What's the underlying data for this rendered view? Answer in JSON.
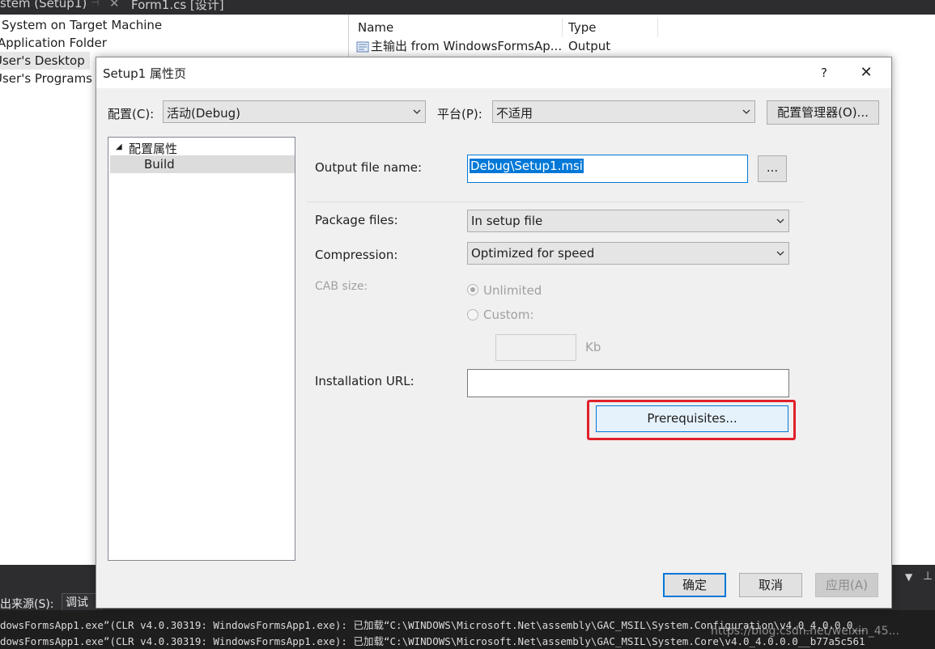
{
  "ide": {
    "tabs": [
      {
        "label": "stem (Setup1)"
      },
      {
        "label": "Form1.cs [设计]"
      }
    ],
    "tab_pin_icon": "pin-icon",
    "tab_close_icon": "close-icon",
    "file_system_tree": [
      {
        "label": "System on Target Machine"
      },
      {
        "label": "Application Folder"
      },
      {
        "label": "User's Desktop"
      },
      {
        "label": "User's Programs Menu"
      }
    ],
    "list_columns": [
      "Name",
      "Type"
    ],
    "list_rows": [
      {
        "name": "主输出 from WindowsFormsAp...",
        "type": "Output"
      }
    ],
    "output_panel": {
      "source_label": "出来源(S):",
      "source_value": "调试",
      "lines": [
        "dowsFormsApp1.exe”(CLR v4.0.30319: WindowsFormsApp1.exe): 已加载“C:\\WINDOWS\\Microsoft.Net\\assembly\\GAC_MSIL\\System.Configuration\\v4.0_4.0.0.0__",
        "dowsFormsApp1.exe”(CLR v4.0.30319: WindowsFormsApp1.exe): 已加载“C:\\WINDOWS\\Microsoft.Net\\assembly\\GAC_MSIL\\System.Core\\v4.0_4.0.0.0__b77a5c561"
      ]
    },
    "watermark": "https://blog.csdn.net/weixin_45..."
  },
  "dialog": {
    "title": "Setup1 属性页",
    "help_label": "?",
    "close_label": "✕",
    "config_label": "配置(C):",
    "config_value": "活动(Debug)",
    "platform_label": "平台(P):",
    "platform_value": "不适用",
    "config_manager_label": "配置管理器(O)...",
    "tree": {
      "root_label": "配置属性",
      "child_label": "Build"
    },
    "output_file_label": "Output file name:",
    "output_file_value": "Debug\\Setup1.msi",
    "browse_label": "...",
    "package_files_label": "Package files:",
    "package_files_value": "In setup file",
    "compression_label": "Compression:",
    "compression_value": "Optimized for speed",
    "cab_size_label": "CAB size:",
    "cab_unlimited_label": "Unlimited",
    "cab_custom_label": "Custom:",
    "cab_unit_label": "Kb",
    "cab_selected": "Unlimited",
    "installation_url_label": "Installation URL:",
    "installation_url_value": "",
    "prerequisites_label": "Prerequisites...",
    "ok_label": "确定",
    "cancel_label": "取消",
    "apply_label": "应用(A)",
    "highlight_color": "#e0202a",
    "accent_color": "#0078d7"
  }
}
